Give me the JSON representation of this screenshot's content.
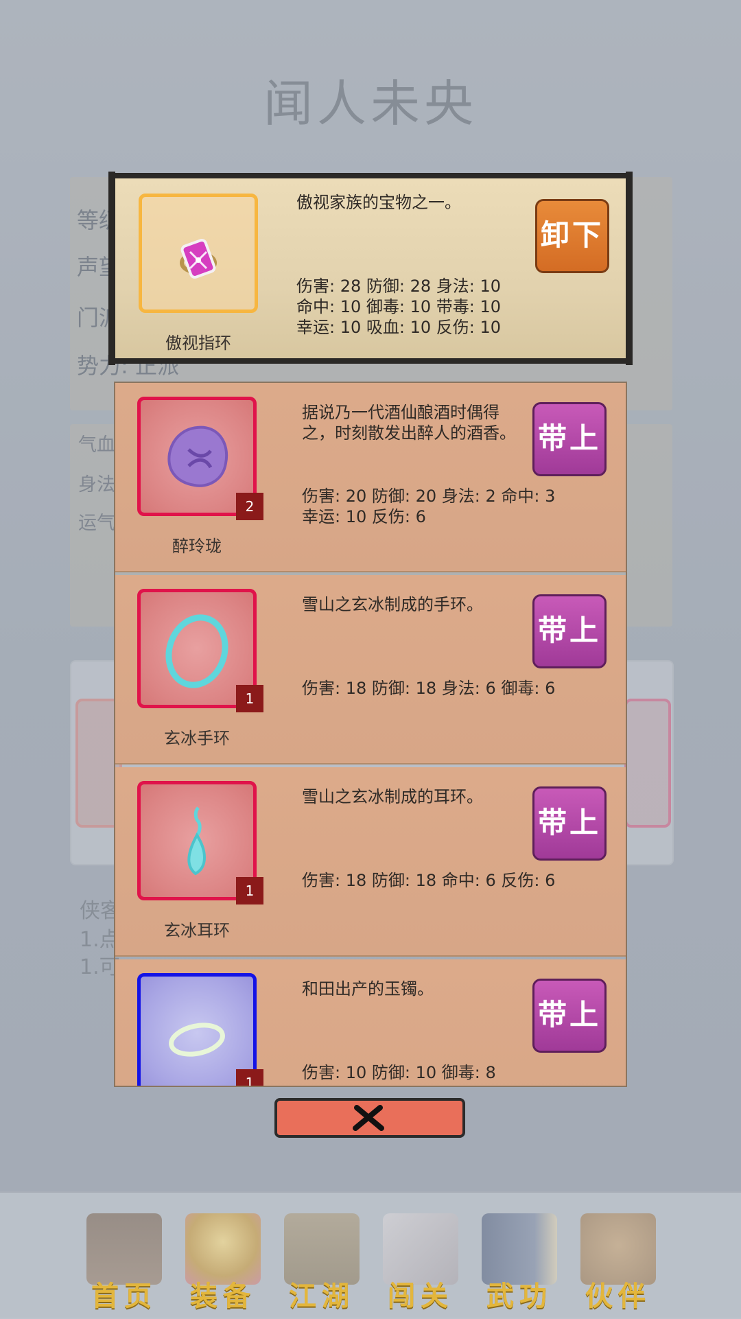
{
  "page": {
    "title": "闻人未央"
  },
  "background_info": {
    "lines": [
      "等级",
      "声望",
      "门派",
      "势力: 正派"
    ]
  },
  "background_stats": {
    "lines": [
      "气血",
      "身法",
      "运气"
    ]
  },
  "background_tips": {
    "lines": [
      "侠客",
      "1.点",
      "1.可"
    ]
  },
  "equipped": {
    "name": "傲视指环",
    "description": "傲视家族的宝物之一。",
    "stats": [
      "伤害: 28 防御: 28 身法: 10",
      "命中: 10 御毒: 10 带毒: 10",
      "幸运: 10 吸血: 10 反伤: 10"
    ],
    "action_label": "卸下",
    "icon": "ring-icon"
  },
  "inventory": [
    {
      "name": "醉玲珑",
      "count": "2",
      "description": "据说乃一代酒仙酿酒时偶得之，时刻散发出醉人的酒香。",
      "stats": [
        "伤害: 20 防御: 20 身法: 2 命中: 3",
        "幸运: 10 反伤: 6"
      ],
      "action_label": "带上",
      "icon": "wine-jade-icon"
    },
    {
      "name": "玄冰手环",
      "count": "1",
      "description": "雪山之玄冰制成的手环。",
      "stats": [
        "伤害: 18 防御: 18 身法: 6 御毒: 6"
      ],
      "action_label": "带上",
      "icon": "ice-bracelet-icon"
    },
    {
      "name": "玄冰耳环",
      "count": "1",
      "description": "雪山之玄冰制成的耳环。",
      "stats": [
        "伤害: 18 防御: 18 命中: 6 反伤: 6"
      ],
      "action_label": "带上",
      "icon": "ice-earring-icon"
    },
    {
      "name": "",
      "count": "1",
      "description": "和田出产的玉镯。",
      "stats": [
        "伤害: 10 防御: 10 御毒: 8"
      ],
      "action_label": "带上",
      "icon": "jade-bracelet-icon"
    }
  ],
  "nav": [
    {
      "label": "首页",
      "icon": "home-icon"
    },
    {
      "label": "装备",
      "icon": "armor-icon"
    },
    {
      "label": "江湖",
      "icon": "scroll-map-icon"
    },
    {
      "label": "闯关",
      "icon": "crossed-swords-icon"
    },
    {
      "label": "武功",
      "icon": "book-icon"
    },
    {
      "label": "伙伴",
      "icon": "companions-icon"
    }
  ],
  "colors": {
    "equip_button": "#b04aa8",
    "unequip_button": "#e07b30",
    "badge": "#8b1a1a",
    "nav_label": "#e3b63c"
  }
}
